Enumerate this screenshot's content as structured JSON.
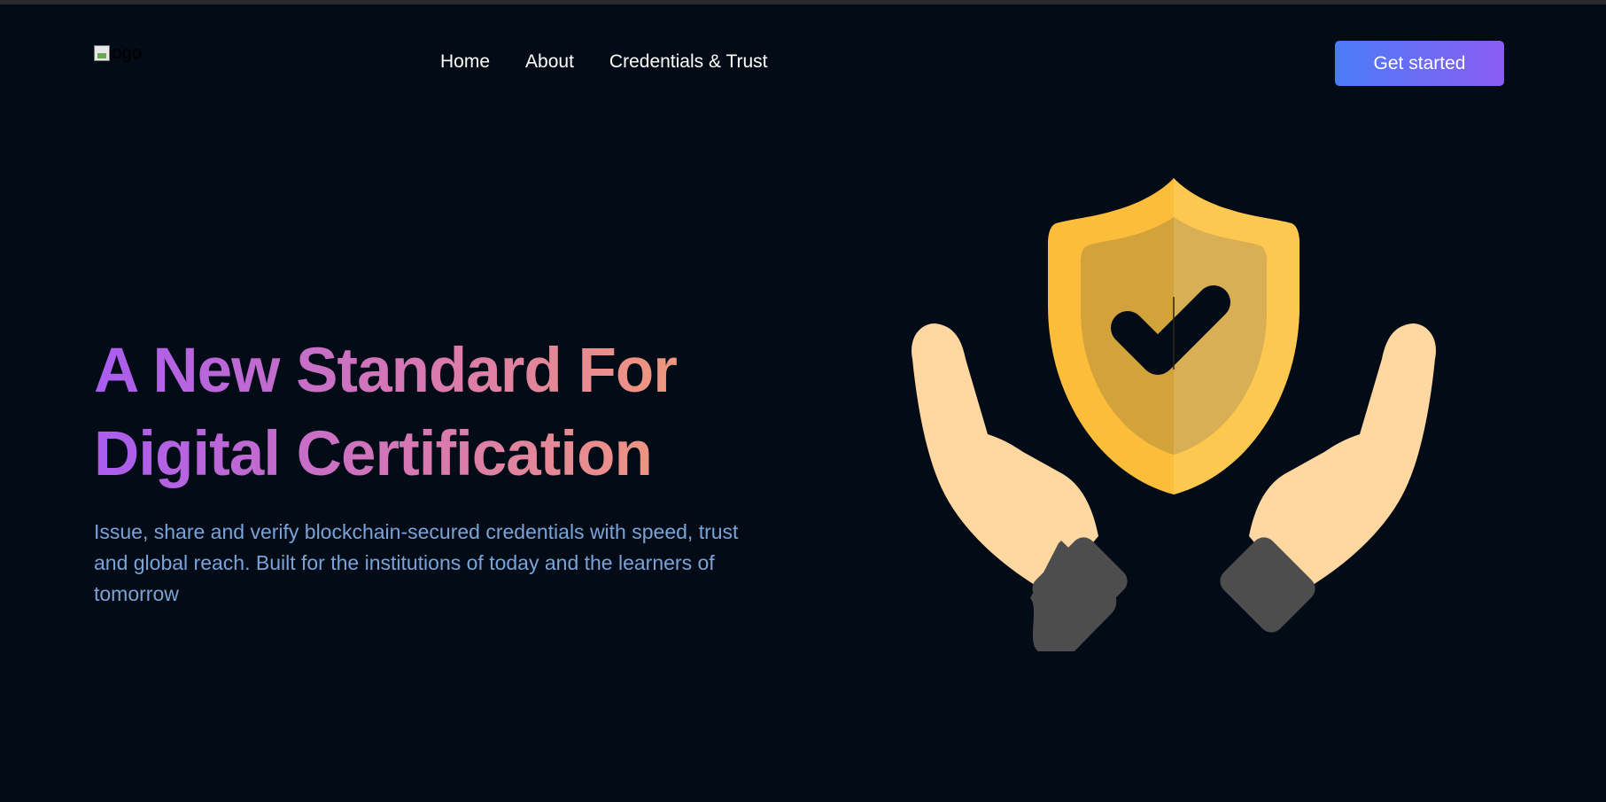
{
  "header": {
    "logo_alt": "logo",
    "nav": [
      {
        "label": "Home"
      },
      {
        "label": "About"
      },
      {
        "label": "Credentials & Trust"
      }
    ],
    "cta_label": "Get started"
  },
  "hero": {
    "title_line1": "A New Standard For",
    "title_line2": "Digital Certification",
    "subtitle": "Issue, share and verify blockchain-secured credentials with speed, trust and global reach. Built for the institutions of today and the learners of tomorrow",
    "illustration": "shield-check-hands-icon"
  },
  "colors": {
    "background": "#030b16",
    "cta_gradient_start": "#4a7cf7",
    "cta_gradient_end": "#8a5cf3",
    "title_gradient_start": "#a95cf0",
    "title_gradient_end": "#f29a78",
    "subtitle": "#7aa3d8",
    "shield": "#fbbd3a",
    "hands": "#ffd7a1",
    "cuffs": "#4d4d4d"
  }
}
